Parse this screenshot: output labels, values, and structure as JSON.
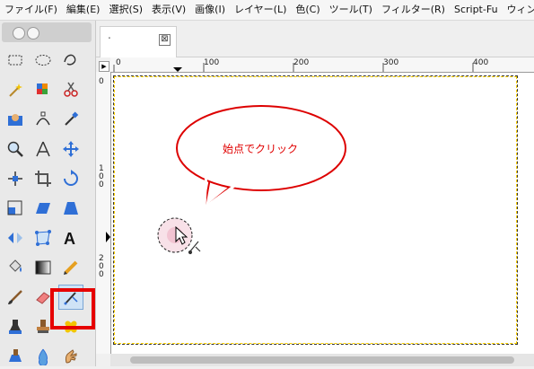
{
  "menubar": {
    "items": [
      "ファイル(F)",
      "編集(E)",
      "選択(S)",
      "表示(V)",
      "画像(I)",
      "レイヤー(L)",
      "色(C)",
      "ツール(T)",
      "フィルター(R)",
      "Script-Fu",
      "ウィン"
    ]
  },
  "tab": {
    "title": ".",
    "close_label": "⊠"
  },
  "ruler": {
    "h_labels": [
      "0",
      "100",
      "200",
      "300",
      "400"
    ],
    "v_labels": [
      "0",
      "1\n0\n0",
      "2\n0\n0"
    ]
  },
  "canvas": {
    "annotation_text": "始点でクリック"
  },
  "toolbox": {
    "tools": [
      "rect-select-icon",
      "ellipse-select-icon",
      "free-select-icon",
      "fuzzy-select-icon",
      "select-by-color-icon",
      "scissors-icon",
      "foreground-select-icon",
      "paths-icon",
      "color-picker-icon",
      "zoom-icon",
      "measure-icon",
      "move-icon",
      "align-icon",
      "crop-icon",
      "rotate-icon",
      "scale-icon",
      "shear-icon",
      "perspective-icon",
      "flip-icon",
      "cage-icon",
      "text-icon",
      "bucket-fill-icon",
      "blend-icon",
      "pencil-icon",
      "paintbrush-icon",
      "eraser-icon",
      "airbrush-icon",
      "ink-icon",
      "clone-icon",
      "heal-icon",
      "perspective-clone-icon",
      "blur-icon",
      "smudge-icon"
    ],
    "active_tool": "airbrush-icon"
  },
  "colors": {
    "highlight": "#e60000",
    "annotation": "#e00000"
  }
}
